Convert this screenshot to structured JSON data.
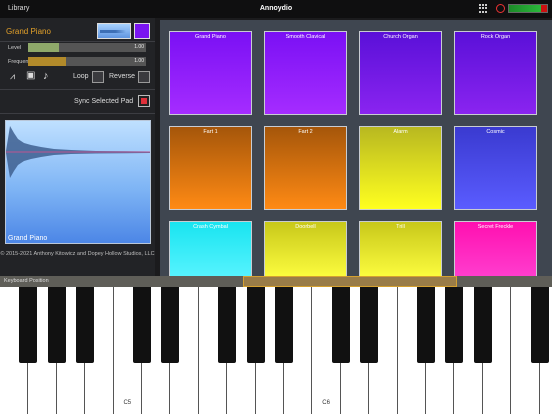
{
  "topbar": {
    "library_label": "Library",
    "app_title": "Annoydio",
    "icons": [
      "grid-icon",
      "record-icon",
      "level-meter"
    ]
  },
  "pad_editor": {
    "pad_name": "Grand Piano",
    "pad_color": "#7a15f0",
    "level": {
      "label": "Level",
      "value": "1.00",
      "fill": 0.26,
      "color": "#8fa96a"
    },
    "frequency": {
      "label": "Frequency",
      "value": "1.00",
      "fill": 0.32,
      "color": "#b28a2a"
    },
    "icons": [
      "envelope-icon",
      "save-icon",
      "note-icon"
    ],
    "loop_label": "Loop",
    "reverse_label": "Reverse",
    "sync_label": "Sync Selected Pad",
    "waveform_label": "Grand Piano",
    "copyright": "© 2015-2021 Anthony Kitowicz and Dopey Hollow Studios, LLC"
  },
  "pads": [
    {
      "label": "Grand Piano",
      "top": "#7a10f4",
      "bottom": "#a52cff"
    },
    {
      "label": "Smooth Clavical",
      "top": "#7a10f4",
      "bottom": "#a52cff"
    },
    {
      "label": "Church Organ",
      "top": "#5a10d8",
      "bottom": "#8a24f0"
    },
    {
      "label": "Rock Organ",
      "top": "#5a10d8",
      "bottom": "#8a24f0"
    },
    {
      "label": "Fart 1",
      "top": "#a5560a",
      "bottom": "#ff8a14"
    },
    {
      "label": "Fart 2",
      "top": "#a5560a",
      "bottom": "#ff8a14"
    },
    {
      "label": "Alarm",
      "top": "#b8b820",
      "bottom": "#ffff20"
    },
    {
      "label": "Cosmic",
      "top": "#3a3ad0",
      "bottom": "#5a5cff"
    },
    {
      "label": "Crash Cymbal",
      "top": "#19e4f0",
      "bottom": "#5af4ff"
    },
    {
      "label": "Doorbell",
      "top": "#c8c81a",
      "bottom": "#ffff40"
    },
    {
      "label": "Trill",
      "top": "#c8c81a",
      "bottom": "#ffff40"
    },
    {
      "label": "Secret Freckle",
      "top": "#ff10b0",
      "bottom": "#ff40d0"
    }
  ],
  "keyboard": {
    "position_label": "Keyboard Position",
    "note_labels": {
      "c5": "C5",
      "c6": "C6"
    }
  }
}
